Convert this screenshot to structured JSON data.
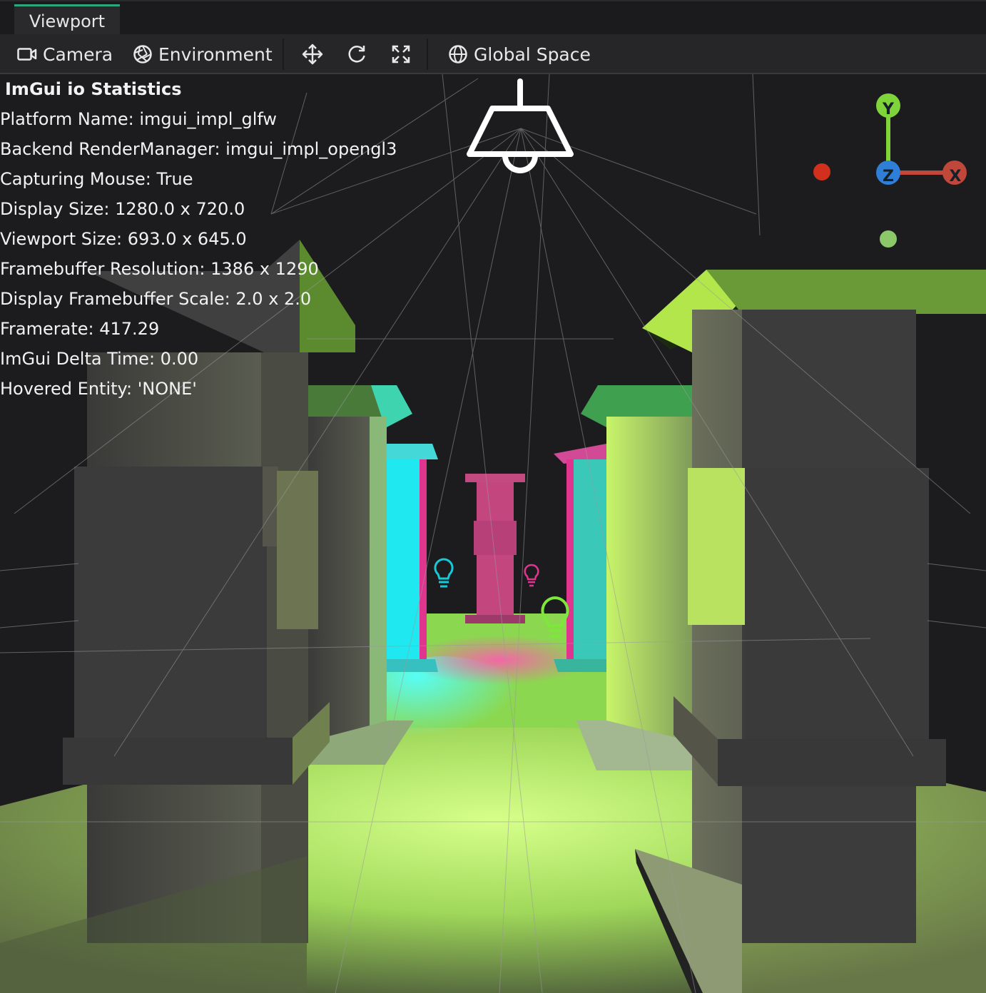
{
  "tab": {
    "label": "Viewport",
    "accent": "#2fa77c"
  },
  "toolbar": {
    "camera_label": "Camera",
    "environment_label": "Environment",
    "space_label": "Global Space",
    "icons": [
      "camera-icon",
      "environment-icon",
      "move-icon",
      "rotate-icon",
      "scale-icon",
      "globe-icon"
    ]
  },
  "stats": {
    "title": "ImGui io Statistics",
    "rows": [
      "Platform Name: imgui_impl_glfw",
      "Backend RenderManager: imgui_impl_opengl3",
      "Capturing Mouse: True",
      "Display Size: 1280.0 x 720.0",
      "Viewport Size: 693.0 x 645.0",
      "Framebuffer Resolution: 1386 x 1290",
      "Display Framebuffer Scale: 2.0 x 2.0",
      "Framerate: 417.29",
      "ImGui Delta Time: 0.00",
      "Hovered Entity: 'NONE'"
    ]
  },
  "gizmo": {
    "y_label": "Y",
    "z_label": "Z",
    "x_label": "X",
    "y_color": "#7fd43a",
    "z_color": "#2f7fd8",
    "x_color": "#c0483a",
    "neg_x_color": "#d0301c",
    "neg_y_color": "#8cc86a"
  },
  "lights": {
    "cyan": "#17c8d8",
    "magenta": "#e0358f",
    "green": "#7ee83a"
  }
}
